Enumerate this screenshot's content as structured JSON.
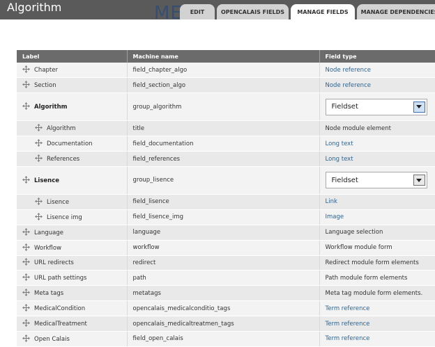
{
  "header": {
    "title": "Algorithm",
    "ghost_text": "ME"
  },
  "tabs": [
    {
      "label": "EDIT",
      "active": false
    },
    {
      "label": "OPENCALAIS FIELDS",
      "active": false
    },
    {
      "label": "MANAGE FIELDS",
      "active": true
    },
    {
      "label": "MANAGE DEPENDENCIES",
      "active": false
    }
  ],
  "table": {
    "columns": [
      "Label",
      "Machine name",
      "Field type"
    ],
    "rows": [
      {
        "label": "Chapter",
        "machine": "field_chapter_algo",
        "type": "Node reference",
        "link": true
      },
      {
        "label": "Section",
        "machine": "field_section_algo",
        "type": "Node reference",
        "link": true
      },
      {
        "label": "Algorithm",
        "machine": "group_algorithm",
        "type": "Fieldset",
        "group": true,
        "focused": true
      },
      {
        "label": "Algorithm",
        "machine": "title",
        "type": "Node module element",
        "indent": true
      },
      {
        "label": "Documentation",
        "machine": "field_documentation",
        "type": "Long text",
        "link": true,
        "indent": true
      },
      {
        "label": "References",
        "machine": "field_references",
        "type": "Long text",
        "link": true,
        "indent": true
      },
      {
        "label": "Lisence",
        "machine": "group_lisence",
        "type": "Fieldset",
        "group": true
      },
      {
        "label": "Lisence",
        "machine": "field_lisence",
        "type": "Link",
        "link": true,
        "indent": true
      },
      {
        "label": "Lisence img",
        "machine": "field_lisence_img",
        "type": "Image",
        "link": true,
        "indent": true
      },
      {
        "label": "Language",
        "machine": "language",
        "type": "Language selection"
      },
      {
        "label": "Workflow",
        "machine": "workflow",
        "type": "Workflow module form"
      },
      {
        "label": "URL redirects",
        "machine": "redirect",
        "type": "Redirect module form elements"
      },
      {
        "label": "URL path settings",
        "machine": "path",
        "type": "Path module form elements"
      },
      {
        "label": "Meta tags",
        "machine": "metatags",
        "type": "Meta tag module form elements."
      },
      {
        "label": "MedicalCondition",
        "machine": "opencalais_medicalconditio_tags",
        "type": "Term reference",
        "link": true
      },
      {
        "label": "MedicalTreatment",
        "machine": "opencalais_medicaltreatmen_tags",
        "type": "Term reference",
        "link": true
      },
      {
        "label": "Open Calais",
        "machine": "field_open_calais",
        "type": "Term reference",
        "link": true
      }
    ]
  },
  "colors": {
    "header_bg": "#5a5a5a",
    "table_header_bg": "#6b6b6b",
    "link": "#2a6496",
    "tab_bg": "#d2d2d2"
  },
  "icons": {
    "drag_handle": "move-arrows-icon",
    "select_arrow": "chevron-down-icon"
  }
}
